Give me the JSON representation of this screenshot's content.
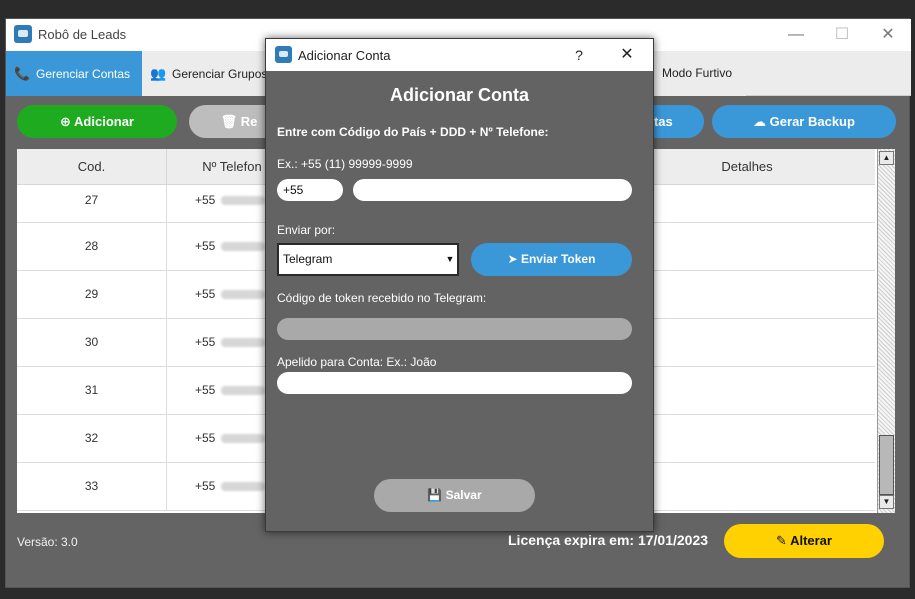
{
  "app": {
    "title": "Robô de Leads",
    "minimize": "—",
    "maximize": "☐",
    "close": "✕"
  },
  "tabs": [
    {
      "label": "Gerenciar Contas",
      "icon": "phone-icon",
      "glyph": "📞"
    },
    {
      "label": "Gerenciar Grupos",
      "icon": "group-icon",
      "glyph": "👥"
    },
    {
      "label": "Modo Furtivo"
    }
  ],
  "actions": {
    "adicionar": "Adicionar",
    "remover": "Re",
    "contas": "ntas",
    "backup": "Gerar Backup"
  },
  "table": {
    "columns": [
      "Cod.",
      "Nº Telefon",
      "Detalhes"
    ],
    "rows": [
      {
        "cod": "27",
        "tel": "+55"
      },
      {
        "cod": "28",
        "tel": "+55"
      },
      {
        "cod": "29",
        "tel": "+55"
      },
      {
        "cod": "30",
        "tel": "+55"
      },
      {
        "cod": "31",
        "tel": "+55"
      },
      {
        "cod": "32",
        "tel": "+55"
      },
      {
        "cod": "33",
        "tel": "+55"
      }
    ]
  },
  "footer": {
    "versao": "Versão: 3.0",
    "licenca": "Licença expira em: 17/01/2023",
    "alterar": "Alterar"
  },
  "dialog": {
    "title": "Adicionar Conta",
    "help": "?",
    "close": "✕",
    "heading": "Adicionar Conta",
    "instruction": "Entre com Código do País + DDD + Nº Telefone:",
    "example": "Ex.: +55 (11) 99999-9999",
    "country_code": "+55",
    "phone_value": "",
    "send_via_label": "Enviar por:",
    "send_via_value": "Telegram",
    "send_token": "Enviar Token",
    "token_label": "Código de token recebido no Telegram:",
    "token_value": "",
    "nickname_label": "Apelido para Conta: Ex.: João",
    "nickname_value": "",
    "save": "Salvar"
  },
  "colors": {
    "primary_blue": "#3b98d8",
    "green": "#1fab1f",
    "yellow": "#ffd100",
    "disabled_gray": "#a9a9a9",
    "panel": "#646464"
  }
}
